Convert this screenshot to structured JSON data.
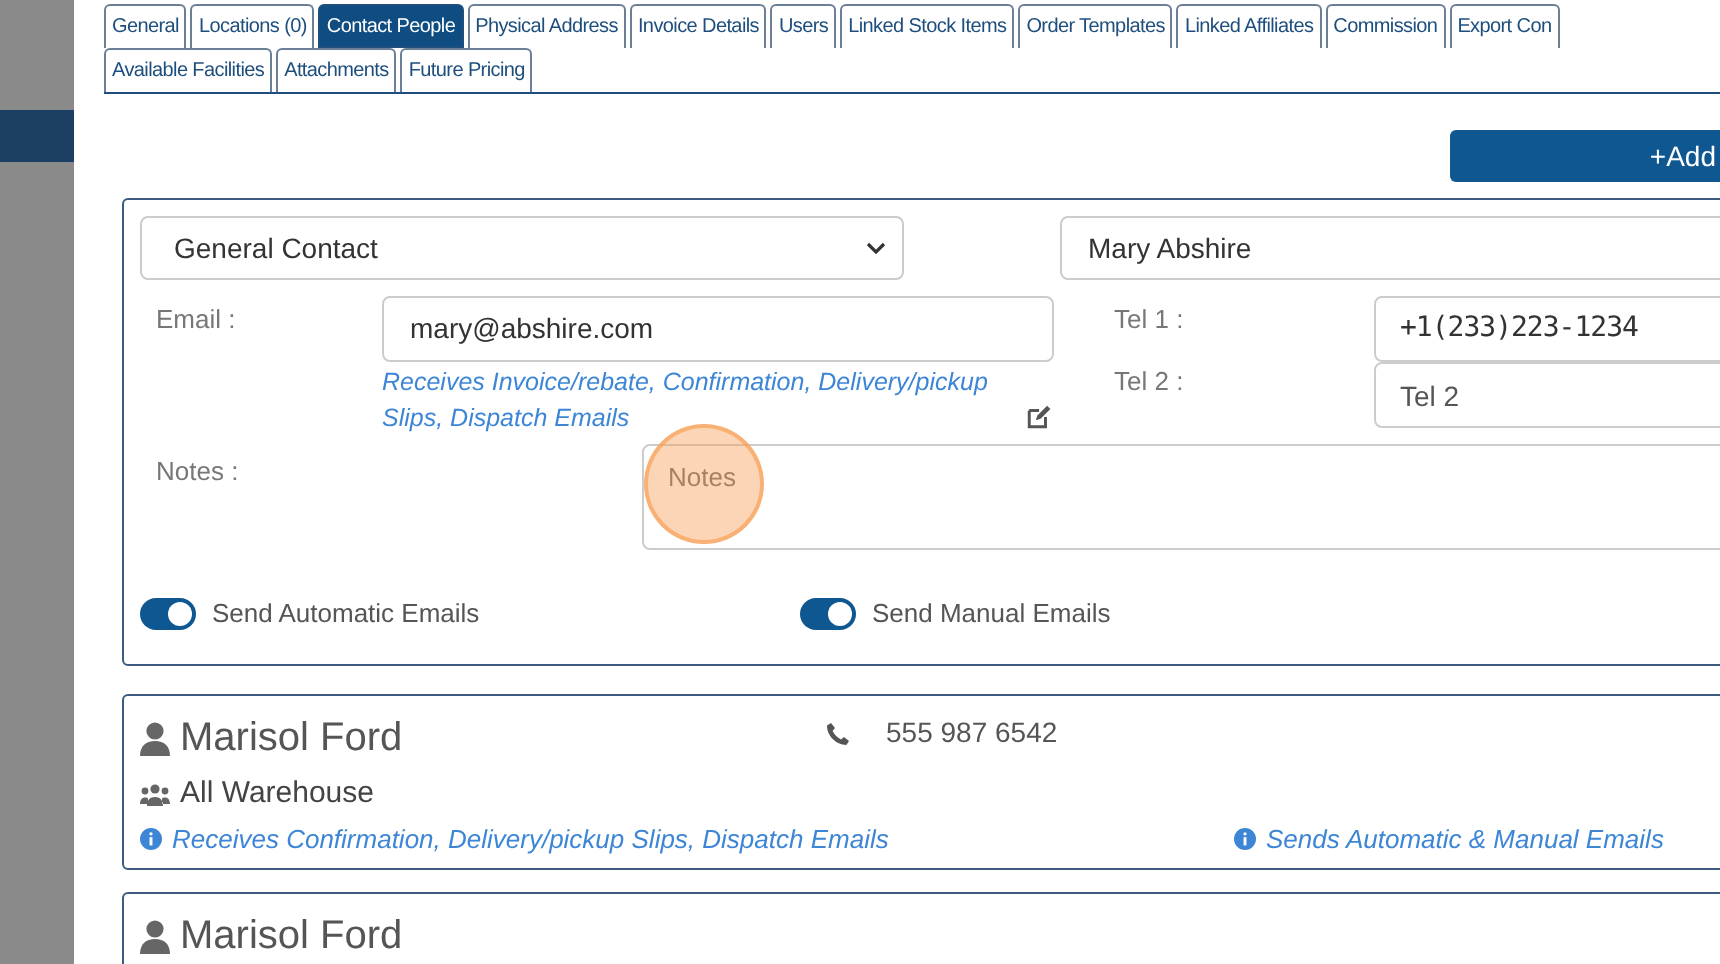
{
  "tabs_row_1": [
    {
      "label": "General",
      "selected": false
    },
    {
      "label": "Locations (0)",
      "selected": false
    },
    {
      "label": "Contact People",
      "selected": true
    },
    {
      "label": "Physical Address",
      "selected": false
    },
    {
      "label": "Invoice Details",
      "selected": false
    },
    {
      "label": "Users",
      "selected": false
    },
    {
      "label": "Linked Stock Items",
      "selected": false
    },
    {
      "label": "Order Templates",
      "selected": false
    },
    {
      "label": "Linked Affiliates",
      "selected": false
    },
    {
      "label": "Commission",
      "selected": false
    },
    {
      "label": "Export Con",
      "selected": false
    }
  ],
  "tabs_row_2": [
    {
      "label": "Available Facilities",
      "selected": false
    },
    {
      "label": "Attachments",
      "selected": false
    },
    {
      "label": "Future Pricing",
      "selected": false
    }
  ],
  "add_button": "+Add",
  "contact_form": {
    "contact_type": "General Contact",
    "name": "Mary Abshire",
    "email_label": "Email :",
    "email": "mary@abshire.com",
    "email_note": "Receives Invoice/rebate, Confirmation, Delivery/pickup Slips, Dispatch Emails",
    "tel1_label": "Tel 1 :",
    "tel1": "+1(233)223-1234",
    "tel2_label": "Tel 2 :",
    "tel2_placeholder": "Tel 2",
    "notes_label": "Notes :",
    "notes_placeholder": "Notes",
    "toggles": [
      {
        "label": "Send Automatic Emails",
        "on": true
      },
      {
        "label": "Send Manual Emails",
        "on": true
      }
    ]
  },
  "contacts": [
    {
      "name": "Marisol Ford",
      "phone": "555 987 6542",
      "group": "All Warehouse",
      "receives": "Receives Confirmation, Delivery/pickup Slips, Dispatch Emails",
      "sends": "Sends Automatic & Manual Emails"
    },
    {
      "name": "Marisol Ford"
    }
  ]
}
